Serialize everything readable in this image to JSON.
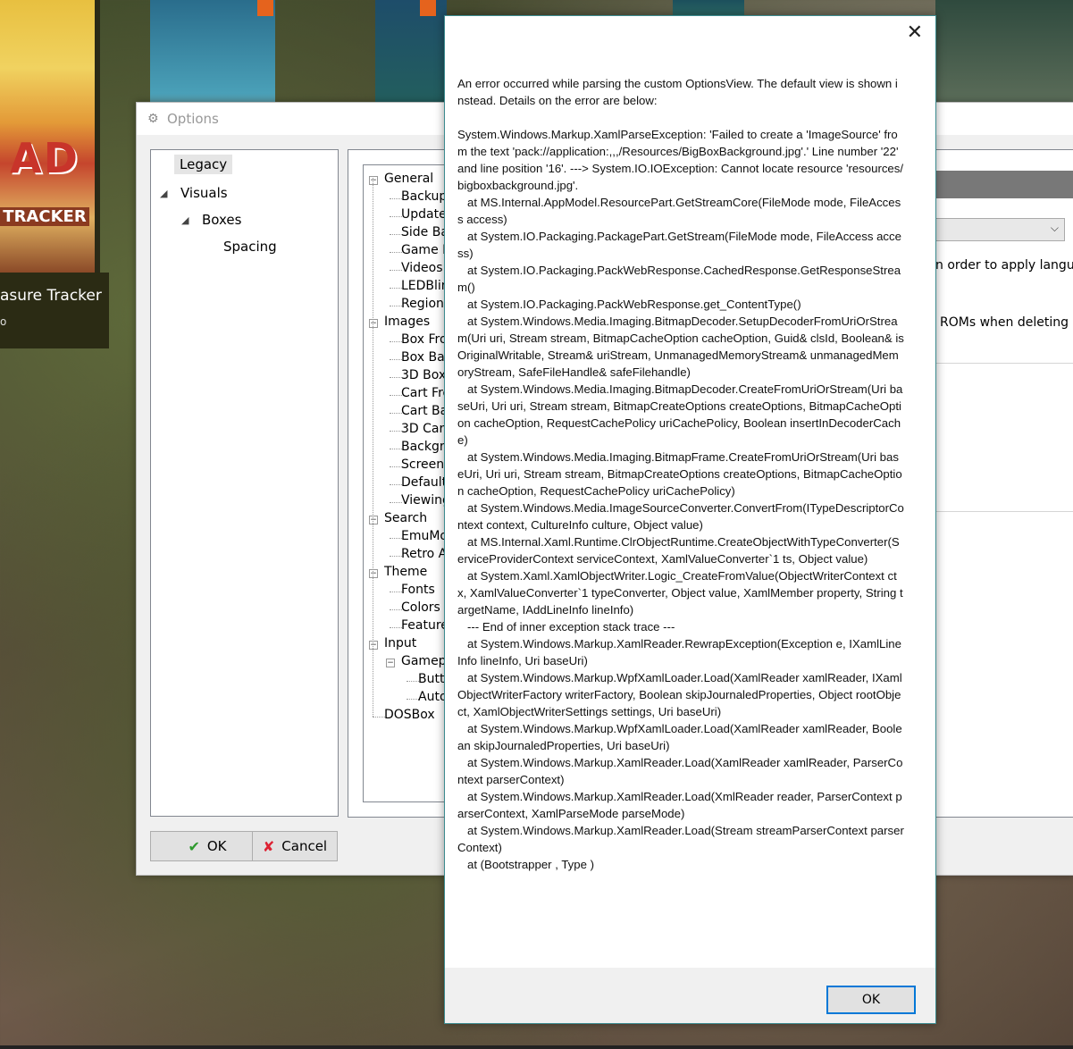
{
  "background": {
    "cover_caption": "asure Tracker",
    "cover_caption_sub": "o",
    "cover_art_text": "AD",
    "cover_art_sub": "TRACKER"
  },
  "options_window": {
    "title": "Options",
    "title_icon": "gear-icon",
    "left_tree": [
      "Legacy",
      "Visuals",
      "Boxes",
      "Spacing"
    ],
    "inner_tree": [
      {
        "label": "General",
        "level": 0,
        "expander": "−"
      },
      {
        "label": "Backups",
        "level": 1
      },
      {
        "label": "Updates",
        "level": 1
      },
      {
        "label": "Side Bar",
        "level": 1
      },
      {
        "label": "Game D",
        "level": 1
      },
      {
        "label": "Videos",
        "level": 1
      },
      {
        "label": "LEDBlink",
        "level": 1
      },
      {
        "label": "Region",
        "level": 1
      },
      {
        "label": "Images",
        "level": 0,
        "expander": "−"
      },
      {
        "label": "Box Fro",
        "level": 1
      },
      {
        "label": "Box Bac",
        "level": 1
      },
      {
        "label": "3D Box",
        "level": 1
      },
      {
        "label": "Cart Fro",
        "level": 1
      },
      {
        "label": "Cart Bac",
        "level": 1
      },
      {
        "label": "3D Cart",
        "level": 1
      },
      {
        "label": "Backgro",
        "level": 1
      },
      {
        "label": "Screens",
        "level": 1
      },
      {
        "label": "Default",
        "level": 1
      },
      {
        "label": "Viewing",
        "level": 1
      },
      {
        "label": "Search",
        "level": 0,
        "expander": "−"
      },
      {
        "label": "EmuMov",
        "level": 1
      },
      {
        "label": "Retro A",
        "level": 1
      },
      {
        "label": "Theme",
        "level": 0,
        "expander": "−"
      },
      {
        "label": "Fonts",
        "level": 1
      },
      {
        "label": "Colors",
        "level": 1
      },
      {
        "label": "Features",
        "level": 1
      },
      {
        "label": "Input",
        "level": 0,
        "expander": "−"
      },
      {
        "label": "Gamepa",
        "level": 1,
        "expander": "−"
      },
      {
        "label": "Butto",
        "level": 2
      },
      {
        "label": "Auto",
        "level": 2
      },
      {
        "label": "DOSBox",
        "level": 0
      }
    ],
    "right_text_1": "n order to apply language",
    "right_text_2": "ROMs when deleting gam",
    "ok_label": "OK",
    "cancel_label": "Cancel"
  },
  "error_dialog": {
    "close_glyph": "✕",
    "message": "An error occurred while parsing the custom OptionsView. The default view is shown instead. Details on the error are below:\n\nSystem.Windows.Markup.XamlParseException: 'Failed to create a 'ImageSource' from the text 'pack://application:,,,/Resources/BigBoxBackground.jpg'.' Line number '22' and line position '16'. ---> System.IO.IOException: Cannot locate resource 'resources/bigboxbackground.jpg'.\n   at MS.Internal.AppModel.ResourcePart.GetStreamCore(FileMode mode, FileAccess access)\n   at System.IO.Packaging.PackagePart.GetStream(FileMode mode, FileAccess access)\n   at System.IO.Packaging.PackWebResponse.CachedResponse.GetResponseStream()\n   at System.IO.Packaging.PackWebResponse.get_ContentType()\n   at System.Windows.Media.Imaging.BitmapDecoder.SetupDecoderFromUriOrStream(Uri uri, Stream stream, BitmapCacheOption cacheOption, Guid& clsId, Boolean& isOriginalWritable, Stream& uriStream, UnmanagedMemoryStream& unmanagedMemoryStream, SafeFileHandle& safeFilehandle)\n   at System.Windows.Media.Imaging.BitmapDecoder.CreateFromUriOrStream(Uri baseUri, Uri uri, Stream stream, BitmapCreateOptions createOptions, BitmapCacheOption cacheOption, RequestCachePolicy uriCachePolicy, Boolean insertInDecoderCache)\n   at System.Windows.Media.Imaging.BitmapFrame.CreateFromUriOrStream(Uri baseUri, Uri uri, Stream stream, BitmapCreateOptions createOptions, BitmapCacheOption cacheOption, RequestCachePolicy uriCachePolicy)\n   at System.Windows.Media.ImageSourceConverter.ConvertFrom(ITypeDescriptorContext context, CultureInfo culture, Object value)\n   at MS.Internal.Xaml.Runtime.ClrObjectRuntime.CreateObjectWithTypeConverter(ServiceProviderContext serviceContext, XamlValueConverter`1 ts, Object value)\n   at System.Xaml.XamlObjectWriter.Logic_CreateFromValue(ObjectWriterContext ctx, XamlValueConverter`1 typeConverter, Object value, XamlMember property, String targetName, IAddLineInfo lineInfo)\n   --- End of inner exception stack trace ---\n   at System.Windows.Markup.XamlReader.RewrapException(Exception e, IXamlLineInfo lineInfo, Uri baseUri)\n   at System.Windows.Markup.WpfXamlLoader.Load(XamlReader xamlReader, IXamlObjectWriterFactory writerFactory, Boolean skipJournaledProperties, Object rootObject, XamlObjectWriterSettings settings, Uri baseUri)\n   at System.Windows.Markup.WpfXamlLoader.Load(XamlReader xamlReader, Boolean skipJournaledProperties, Uri baseUri)\n   at System.Windows.Markup.XamlReader.Load(XamlReader xamlReader, ParserContext parserContext)\n   at System.Windows.Markup.XamlReader.Load(XmlReader reader, ParserContext parserContext, XamlParseMode parseMode)\n   at System.Windows.Markup.XamlReader.Load(Stream streamParserContext parserContext)\n   at (Bootstrapper , Type )",
    "ok_label": "OK",
    "accent": "#0078d7"
  }
}
